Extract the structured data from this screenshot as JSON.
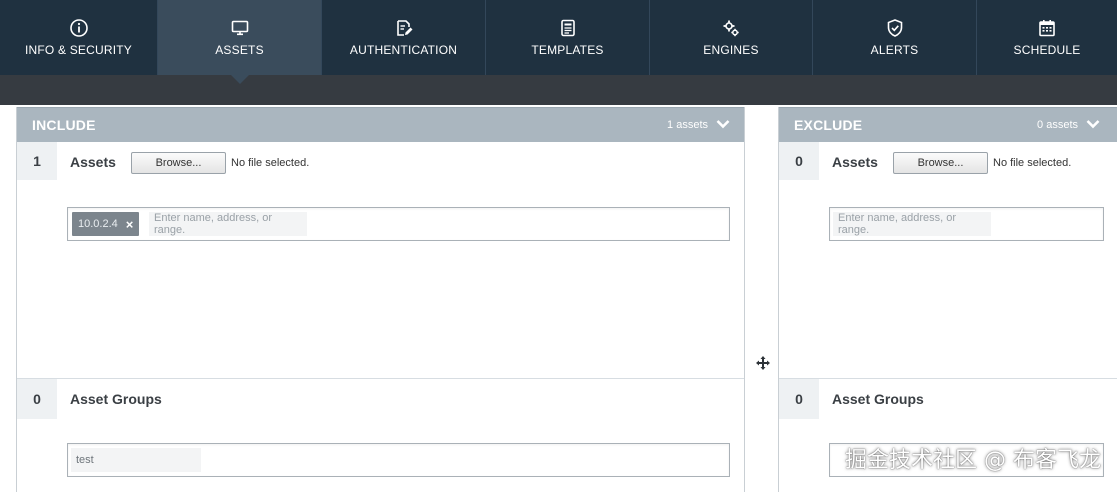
{
  "nav": {
    "tabs": [
      {
        "label": "INFO & SECURITY",
        "icon": "info-circle-icon",
        "active": false
      },
      {
        "label": "ASSETS",
        "icon": "monitor-icon",
        "active": true
      },
      {
        "label": "AUTHENTICATION",
        "icon": "edit-document-icon",
        "active": false
      },
      {
        "label": "TEMPLATES",
        "icon": "template-list-icon",
        "active": false
      },
      {
        "label": "ENGINES",
        "icon": "gears-icon",
        "active": false
      },
      {
        "label": "ALERTS",
        "icon": "shield-check-icon",
        "active": false
      },
      {
        "label": "SCHEDULE",
        "icon": "calendar-icon",
        "active": false
      }
    ]
  },
  "include": {
    "title": "INCLUDE",
    "count_label": "1 assets",
    "assets": {
      "count": "1",
      "label": "Assets",
      "browse_label": "Browse...",
      "file_status": "No file selected.",
      "tokens": [
        "10.0.2.4"
      ],
      "placeholder": "Enter name, address, or range."
    },
    "asset_groups": {
      "count": "0",
      "label": "Asset Groups",
      "value": "test"
    }
  },
  "exclude": {
    "title": "EXCLUDE",
    "count_label": "0 assets",
    "assets": {
      "count": "0",
      "label": "Assets",
      "browse_label": "Browse...",
      "file_status": "No file selected.",
      "placeholder": "Enter name, address, or range."
    },
    "asset_groups": {
      "count": "0",
      "label": "Asset Groups"
    }
  },
  "watermark": "掘金技术社区 @ 布客飞龙",
  "colors": {
    "nav_bg": "#1f3140",
    "nav_active": "#3a4c5c",
    "panel_header": "#aab6bf",
    "token_bg": "#7c858d"
  }
}
